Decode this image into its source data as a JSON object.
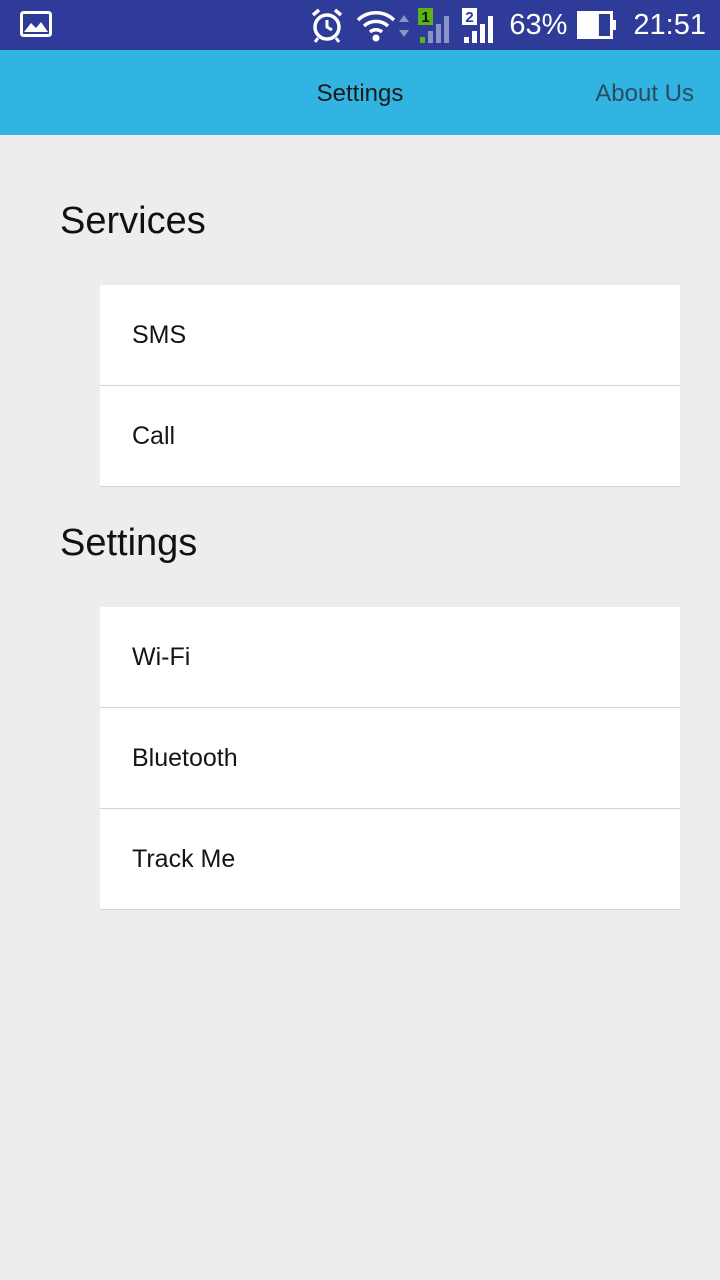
{
  "status_bar": {
    "battery_percent": "63%",
    "time": "21:51",
    "sim1_label": "1",
    "sim2_label": "2",
    "battery_level": 0.63
  },
  "app_bar": {
    "title": "Settings",
    "about_label": "About Us",
    "color": "#31b4e2"
  },
  "sections": [
    {
      "title": "Services",
      "items": [
        "SMS",
        "Call"
      ]
    },
    {
      "title": "Settings",
      "items": [
        "Wi-Fi",
        "Bluetooth",
        "Track Me"
      ]
    }
  ]
}
